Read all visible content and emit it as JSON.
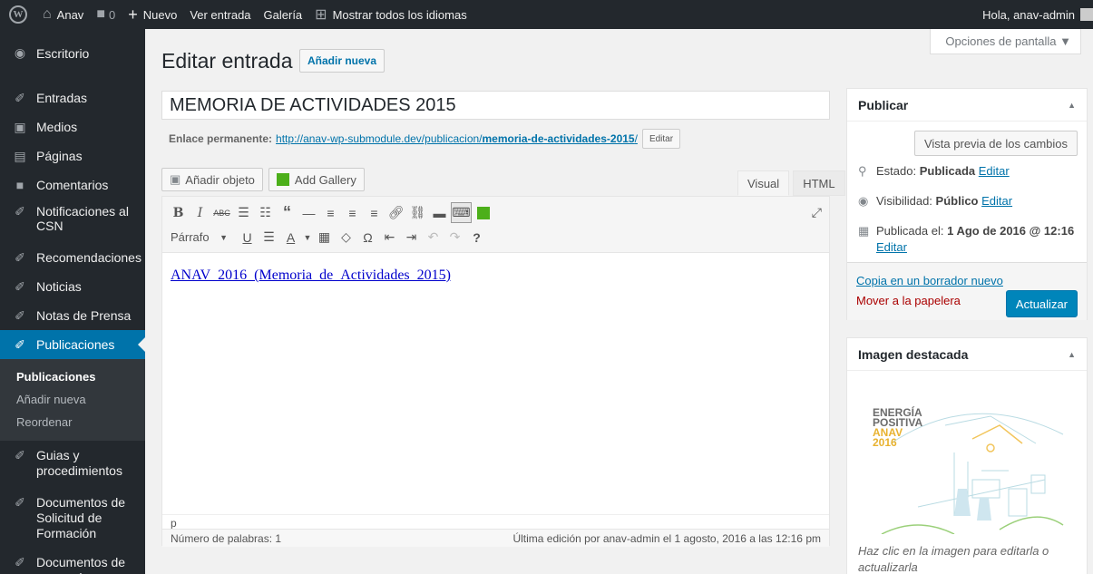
{
  "adminbar": {
    "site_name": "Anav",
    "comments_count": "0",
    "new_label": "Nuevo",
    "view_post": "Ver entrada",
    "gallery": "Galería",
    "languages": "Mostrar todos los idiomas",
    "greeting": "Hola, anav-admin"
  },
  "sidebar": {
    "items": [
      {
        "label": "Escritorio",
        "icon": "dashboard-icon"
      },
      {
        "label": "Entradas",
        "icon": "pin-icon"
      },
      {
        "label": "Medios",
        "icon": "media-icon"
      },
      {
        "label": "Páginas",
        "icon": "page-icon"
      },
      {
        "label": "Comentarios",
        "icon": "comment-icon"
      },
      {
        "label": "Notificaciones al CSN",
        "icon": "pin-icon"
      },
      {
        "label": "Recomendaciones",
        "icon": "pin-icon"
      },
      {
        "label": "Noticias",
        "icon": "pin-icon"
      },
      {
        "label": "Notas de Prensa",
        "icon": "pin-icon"
      },
      {
        "label": "Publicaciones",
        "icon": "pin-icon"
      },
      {
        "label": "Guias y procedimientos",
        "icon": "pin-icon"
      },
      {
        "label": "Documentos de Solicitud de Formación",
        "icon": "pin-icon"
      },
      {
        "label": "Documentos de proveedores",
        "icon": "pin-icon"
      }
    ],
    "submenu": [
      "Publicaciones",
      "Añadir nueva",
      "Reordenar"
    ]
  },
  "header": {
    "screen_options": "Opciones de pantalla ▼",
    "title": "Editar entrada",
    "add_new": "Añadir nueva"
  },
  "post": {
    "title": "MEMORIA DE ACTIVIDADES 2015",
    "permalink_label": "Enlace permanente:",
    "permalink_base": "http://anav-wp-submodule.dev/publicacion/",
    "permalink_slug": "memoria-de-actividades-2015",
    "permalink_trail": "/",
    "edit_label": "Editar"
  },
  "editor": {
    "add_media": "Añadir objeto",
    "add_gallery": "Add Gallery",
    "tab_visual": "Visual",
    "tab_html": "HTML",
    "format": "Párrafo",
    "content_link": "ANAV_2016_(Memoria_de_Actividades_2015)",
    "path": "p",
    "word_count": "Número de palabras: 1",
    "last_edit": "Última edición por anav-admin el 1 agosto, 2016 a las 12:16 pm"
  },
  "publish": {
    "title": "Publicar",
    "preview": "Vista previa de los cambios",
    "status_label": "Estado:",
    "status_value": "Publicada",
    "visibility_label": "Visibilidad:",
    "visibility_value": "Público",
    "published_label": "Publicada el:",
    "published_value": "1 Ago de 2016 @ 12:16",
    "edit": "Editar",
    "copy_draft": "Copia en un borrador nuevo",
    "trash": "Mover a la papelera",
    "update": "Actualizar"
  },
  "featured": {
    "title": "Imagen destacada",
    "img_line1": "ENERGÍA",
    "img_line2": "POSITIVA",
    "img_line3": "ANAV",
    "img_line4": "2016",
    "note": "Haz clic en la imagen para editarla o actualizarla"
  },
  "colors": {
    "accent": "#0073aa",
    "menu_bg": "#23282d",
    "update_btn": "#0085ba"
  }
}
